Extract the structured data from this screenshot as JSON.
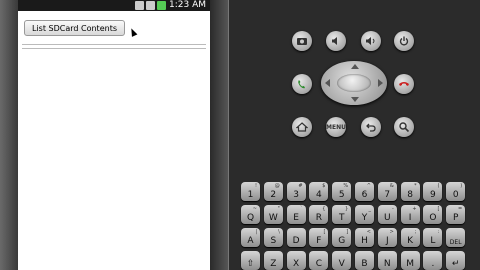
{
  "emulator": {
    "status_bar": {
      "time": "1:23 AM"
    },
    "app": {
      "button_label": "List SDCard Contents"
    },
    "controls": {
      "menu_label": "MENU",
      "icons": [
        "camera-icon",
        "volume-down-icon",
        "volume-up-icon",
        "power-icon",
        "call-icon",
        "end-call-icon",
        "home-icon",
        "back-icon",
        "search-icon"
      ]
    },
    "keyboard": {
      "row1": [
        {
          "main": "1",
          "sub": "!"
        },
        {
          "main": "2",
          "sub": "@"
        },
        {
          "main": "3",
          "sub": "#"
        },
        {
          "main": "4",
          "sub": "$"
        },
        {
          "main": "5",
          "sub": "%"
        },
        {
          "main": "6",
          "sub": "^"
        },
        {
          "main": "7",
          "sub": "&"
        },
        {
          "main": "8",
          "sub": "*"
        },
        {
          "main": "9",
          "sub": "("
        },
        {
          "main": "0",
          "sub": ")"
        }
      ],
      "row2": [
        {
          "main": "Q",
          "sub": "~"
        },
        {
          "main": "W",
          "sub": "\""
        },
        {
          "main": "E",
          "sub": "`"
        },
        {
          "main": "R",
          "sub": "{"
        },
        {
          "main": "T",
          "sub": "}"
        },
        {
          "main": "Y",
          "sub": "_"
        },
        {
          "main": "U",
          "sub": "-"
        },
        {
          "main": "I",
          "sub": "+"
        },
        {
          "main": "O",
          "sub": "["
        },
        {
          "main": "P",
          "sub": "="
        }
      ],
      "row3": [
        {
          "main": "A",
          "sub": "|"
        },
        {
          "main": "S",
          "sub": "\\"
        },
        {
          "main": "D",
          "sub": ""
        },
        {
          "main": "F",
          "sub": "["
        },
        {
          "main": "G",
          "sub": "]"
        },
        {
          "main": "H",
          "sub": "<"
        },
        {
          "main": "J",
          "sub": ">"
        },
        {
          "main": "K",
          "sub": ";"
        },
        {
          "main": "L",
          "sub": ":"
        },
        {
          "main": "DEL",
          "sub": ""
        }
      ],
      "row4": [
        {
          "main": "⇧",
          "sub": ""
        },
        {
          "main": "Z",
          "sub": ""
        },
        {
          "main": "X",
          "sub": ""
        },
        {
          "main": "C",
          "sub": ""
        },
        {
          "main": "V",
          "sub": ""
        },
        {
          "main": "B",
          "sub": ""
        },
        {
          "main": "N",
          "sub": ""
        },
        {
          "main": "M",
          "sub": ""
        },
        {
          "main": ".",
          "sub": ""
        },
        {
          "main": "↵",
          "sub": ""
        }
      ]
    }
  }
}
